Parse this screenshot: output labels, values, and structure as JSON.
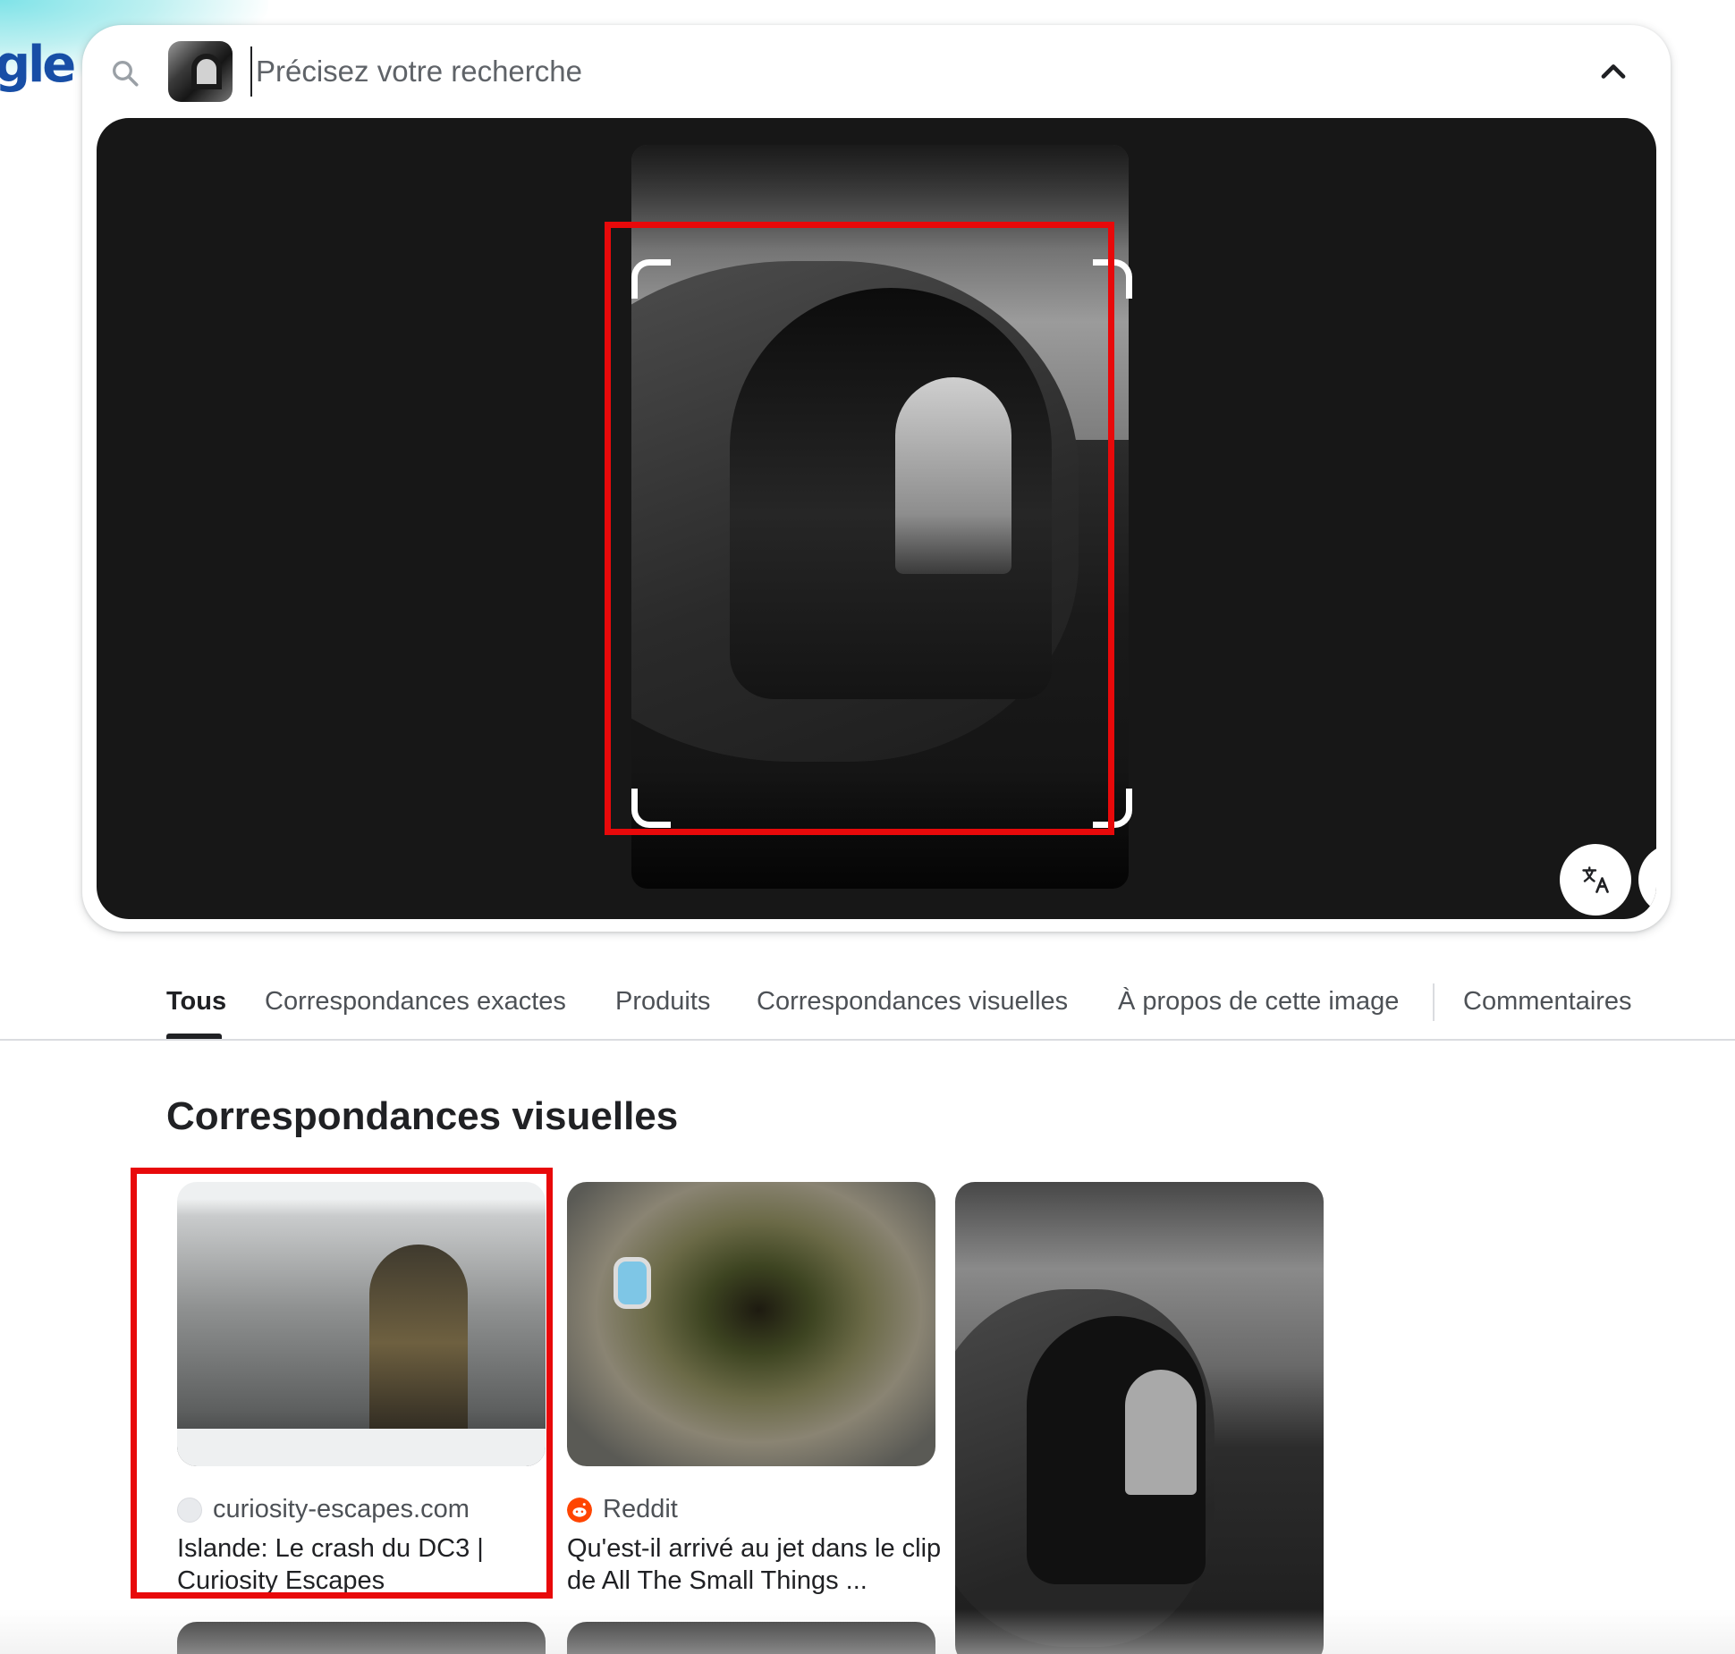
{
  "logo": {
    "text_visible": "gle"
  },
  "search": {
    "placeholder": "Précisez votre recherche",
    "value": ""
  },
  "viewer": {
    "translate_button": "translate-icon",
    "expand_button": "expand-icon"
  },
  "tabs": [
    {
      "label": "Tous",
      "active": true
    },
    {
      "label": "Correspondances exactes",
      "active": false
    },
    {
      "label": "Produits",
      "active": false
    },
    {
      "label": "Correspondances visuelles",
      "active": false
    },
    {
      "label": "À propos de cette image",
      "active": false
    },
    {
      "label": "Commentaires",
      "active": false
    }
  ],
  "section": {
    "title": "Correspondances visuelles"
  },
  "results": [
    {
      "source": "curiosity-escapes.com",
      "title": "Islande: Le crash du DC3 | Curiosity Escapes",
      "favicon": "site-icon"
    },
    {
      "source": "Reddit",
      "title": "Qu'est-il arrivé au jet dans le clip de All The Small Things ...",
      "favicon": "reddit-icon"
    },
    {
      "source": "",
      "title": "",
      "favicon": ""
    }
  ],
  "colors": {
    "highlight": "#e8090a",
    "viewer_bg": "#171717",
    "reddit": "#ff4500"
  }
}
